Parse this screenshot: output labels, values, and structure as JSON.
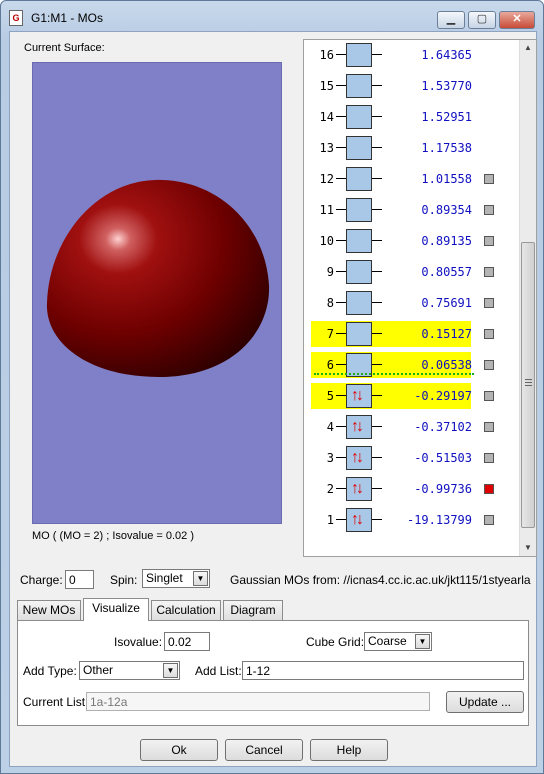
{
  "window": {
    "title": "G1:M1 - MOs",
    "icon_text": "G",
    "controls": {
      "minimize": "▁",
      "maximize": "▢",
      "close": "✕"
    }
  },
  "surface": {
    "label": "Current Surface:",
    "caption": "MO ( (MO = 2) ; Isovalue = 0.02 )",
    "background_color": "#8080c8",
    "object_color": "#8b0000"
  },
  "mo_list": {
    "rows": [
      {
        "num": "16",
        "energy": "1.64365",
        "occupied": false,
        "highlight": false,
        "check": ""
      },
      {
        "num": "15",
        "energy": "1.53770",
        "occupied": false,
        "highlight": false,
        "check": ""
      },
      {
        "num": "14",
        "energy": "1.52951",
        "occupied": false,
        "highlight": false,
        "check": ""
      },
      {
        "num": "13",
        "energy": "1.17538",
        "occupied": false,
        "highlight": false,
        "check": ""
      },
      {
        "num": "12",
        "energy": "1.01558",
        "occupied": false,
        "highlight": false,
        "check": "gray"
      },
      {
        "num": "11",
        "energy": "0.89354",
        "occupied": false,
        "highlight": false,
        "check": "gray"
      },
      {
        "num": "10",
        "energy": "0.89135",
        "occupied": false,
        "highlight": false,
        "check": "gray"
      },
      {
        "num": "9",
        "energy": "0.80557",
        "occupied": false,
        "highlight": false,
        "check": "gray"
      },
      {
        "num": "8",
        "energy": "0.75691",
        "occupied": false,
        "highlight": false,
        "check": "gray"
      },
      {
        "num": "7",
        "energy": "0.15127",
        "occupied": false,
        "highlight": true,
        "check": "gray"
      },
      {
        "num": "6",
        "energy": "0.06538",
        "occupied": false,
        "highlight": true,
        "check": "gray"
      },
      {
        "num": "5",
        "energy": "-0.29197",
        "occupied": true,
        "highlight": true,
        "check": "gray"
      },
      {
        "num": "4",
        "energy": "-0.37102",
        "occupied": true,
        "highlight": false,
        "check": "gray"
      },
      {
        "num": "3",
        "energy": "-0.51503",
        "occupied": true,
        "highlight": false,
        "check": "gray"
      },
      {
        "num": "2",
        "energy": "-0.99736",
        "occupied": true,
        "highlight": false,
        "check": "red"
      },
      {
        "num": "1",
        "energy": "-19.13799",
        "occupied": true,
        "highlight": false,
        "check": "gray"
      }
    ],
    "spin_glyph": "↑↓",
    "scroll_up": "▲",
    "scroll_down": "▼"
  },
  "charge_row": {
    "charge_label": "Charge:",
    "charge_value": "0",
    "spin_label": "Spin:",
    "spin_value": "Singlet",
    "source_text": "Gaussian MOs from:  //icnas4.cc.ic.ac.uk/jkt115/1styearla"
  },
  "tabs": [
    {
      "label": "New MOs",
      "active": false
    },
    {
      "label": "Visualize",
      "active": true
    },
    {
      "label": "Calculation",
      "active": false
    },
    {
      "label": "Diagram",
      "active": false
    }
  ],
  "visualize": {
    "isovalue_label": "Isovalue:",
    "isovalue_value": "0.02",
    "cube_grid_label": "Cube Grid:",
    "cube_grid_value": "Coarse",
    "add_type_label": "Add Type:",
    "add_type_value": "Other",
    "add_list_label": "Add List:",
    "add_list_value": "1-12",
    "current_list_label": "Current List:",
    "current_list_value": "1a-12a",
    "update_label": "Update ..."
  },
  "buttons": {
    "ok": "Ok",
    "cancel": "Cancel",
    "help": "Help"
  },
  "dropdown_glyph": "▼"
}
